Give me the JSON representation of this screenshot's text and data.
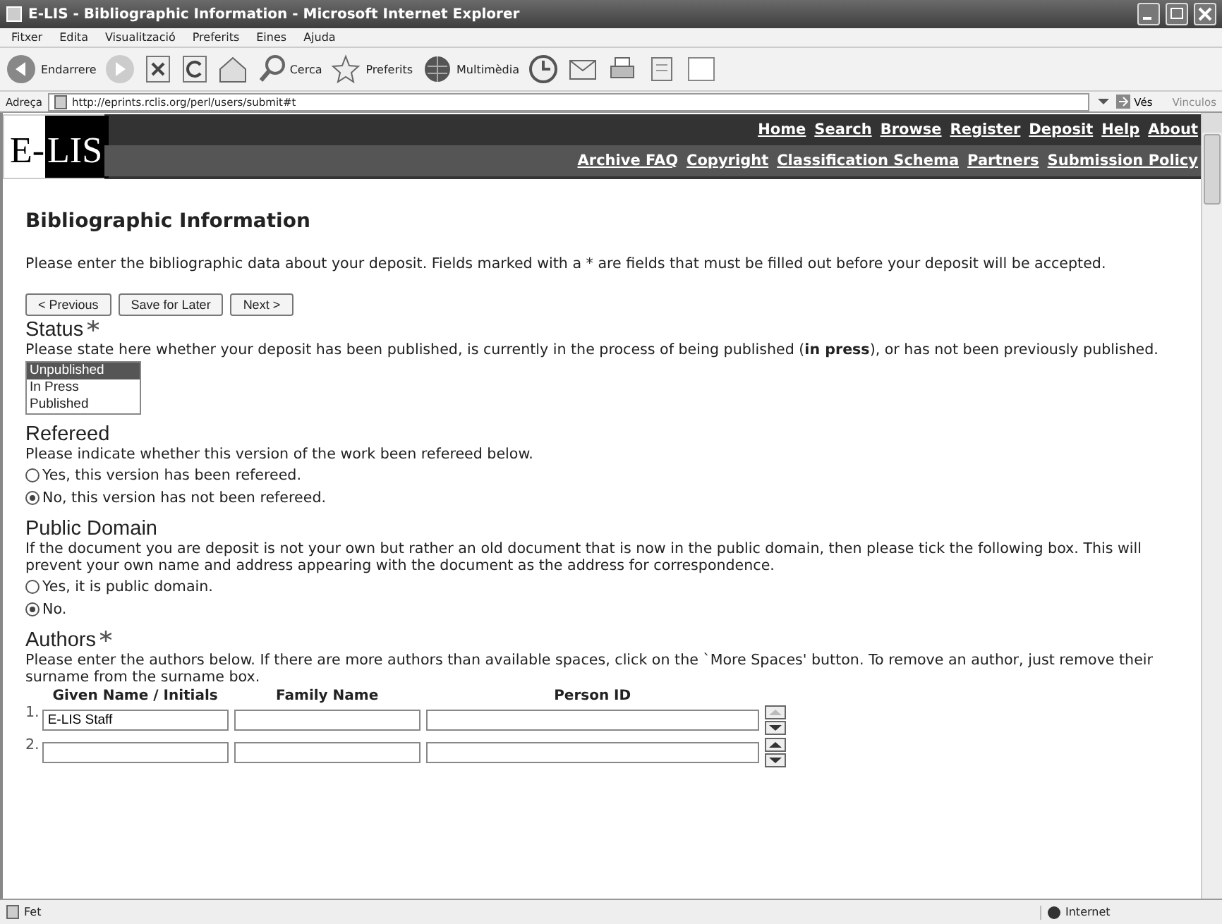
{
  "window": {
    "title": "E-LIS - Bibliographic Information - Microsoft Internet Explorer"
  },
  "menu": [
    "Fitxer",
    "Edita",
    "Visualització",
    "Preferits",
    "Eines",
    "Ajuda"
  ],
  "toolbar": [
    {
      "kind": "back",
      "label": "Endarrere"
    },
    {
      "kind": "forward"
    },
    {
      "kind": "stop"
    },
    {
      "kind": "refresh"
    },
    {
      "kind": "home"
    },
    {
      "kind": "search",
      "label": "Cerca"
    },
    {
      "kind": "favorites",
      "label": "Preferits"
    },
    {
      "kind": "media",
      "label": "Multimèdia"
    },
    {
      "kind": "history"
    },
    {
      "kind": "mail"
    },
    {
      "kind": "print"
    },
    {
      "kind": "edit"
    },
    {
      "kind": "discuss"
    }
  ],
  "address": {
    "label": "Adreça",
    "value": "http://eprints.rclis.org/perl/users/submit#t",
    "go": "Vés",
    "links": "Vinculos"
  },
  "site": {
    "logo_left": "E-",
    "logo_right": "LIS",
    "nav_primary": [
      "Home",
      "Search",
      "Browse",
      "Register",
      "Deposit",
      "Help",
      "About"
    ],
    "nav_secondary": [
      "Archive FAQ",
      "Copyright",
      "Classification Schema",
      "Partners",
      "Submission Policy"
    ]
  },
  "form": {
    "heading": "Bibliographic Information",
    "intro": "Please enter the bibliographic data about your deposit. Fields marked with a * are fields that must be filled out before your deposit will be accepted.",
    "buttons": [
      "< Previous",
      "Save for Later",
      "Next >"
    ],
    "sections": [
      {
        "kind": "listbox",
        "title": "Status",
        "required": true,
        "help": "Please state here whether your deposit has been published, is currently in the process of being published (**in press**), or has not been previously published.",
        "options": [
          {
            "label": "Unpublished",
            "selected": true
          },
          {
            "label": "In Press",
            "selected": false
          },
          {
            "label": "Published",
            "selected": false
          }
        ]
      },
      {
        "kind": "radio",
        "title": "Refereed",
        "required": false,
        "help": "Please indicate whether this version of the work been refereed below.",
        "options": [
          {
            "label": "Yes, this version has been refereed.",
            "selected": false
          },
          {
            "label": "No, this version has not been refereed.",
            "selected": true
          }
        ]
      },
      {
        "kind": "radio",
        "title": "Public Domain",
        "required": false,
        "help": "If the document you are deposit is not your own but rather an old document that is now in the public domain, then please tick the following box. This will prevent your own name and address appearing with the document as the address for correspondence.",
        "options": [
          {
            "label": "Yes, it is public domain.",
            "selected": false
          },
          {
            "label": "No.",
            "selected": true
          }
        ]
      },
      {
        "kind": "authors",
        "title": "Authors",
        "required": true,
        "help": "Please enter the authors below. If there are more authors than available spaces, click on the `More Spaces' button. To remove an author, just remove their surname from the surname box.",
        "columns": [
          "Given Name / Initials",
          "Family Name",
          "Person ID"
        ],
        "rows": [
          {
            "number": "1.",
            "given": "E-LIS Staff",
            "up_disabled": true
          },
          {
            "number": "2.",
            "given": "",
            "up_disabled": false
          }
        ]
      }
    ]
  },
  "status_bar": {
    "text": "Fet",
    "zone": "Internet"
  }
}
